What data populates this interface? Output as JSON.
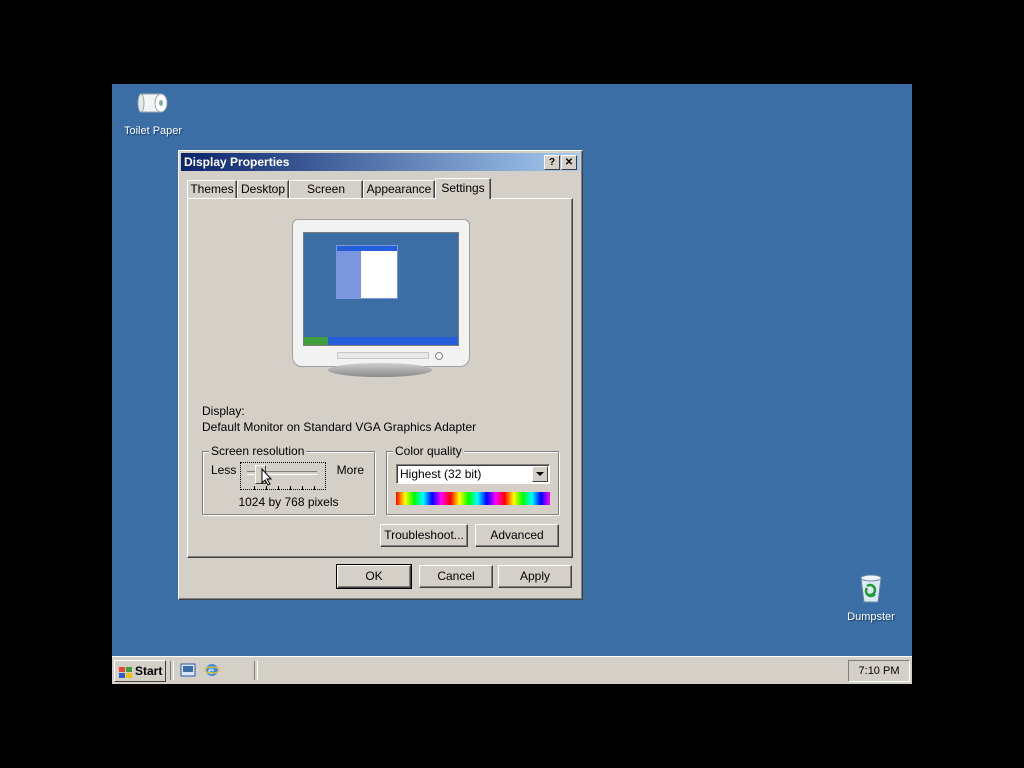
{
  "desktop": {
    "icons": [
      {
        "label": "Toilet Paper",
        "icon": "toilet-paper-icon"
      },
      {
        "label": "Dumpster",
        "icon": "recycle-bin-icon"
      }
    ],
    "background_color": "#3a6ea5"
  },
  "window": {
    "title": "Display Properties",
    "help_glyph": "?",
    "close_glyph": "✕",
    "tabs": [
      {
        "label": "Themes",
        "active": false
      },
      {
        "label": "Desktop",
        "active": false
      },
      {
        "label": "Screen Saver",
        "active": false
      },
      {
        "label": "Appearance",
        "active": false
      },
      {
        "label": "Settings",
        "active": true
      }
    ],
    "display_label": "Display:",
    "display_value": "Default Monitor on Standard VGA Graphics Adapter",
    "resolution": {
      "title": "Screen resolution",
      "less": "Less",
      "more": "More",
      "value_text": "1024 by 768 pixels"
    },
    "color_quality": {
      "title": "Color quality",
      "selected": "Highest (32 bit)"
    },
    "buttons": {
      "troubleshoot": "Troubleshoot...",
      "advanced": "Advanced",
      "ok": "OK",
      "cancel": "Cancel",
      "apply": "Apply"
    }
  },
  "taskbar": {
    "start_label": "Start",
    "clock": "7:10 PM"
  }
}
